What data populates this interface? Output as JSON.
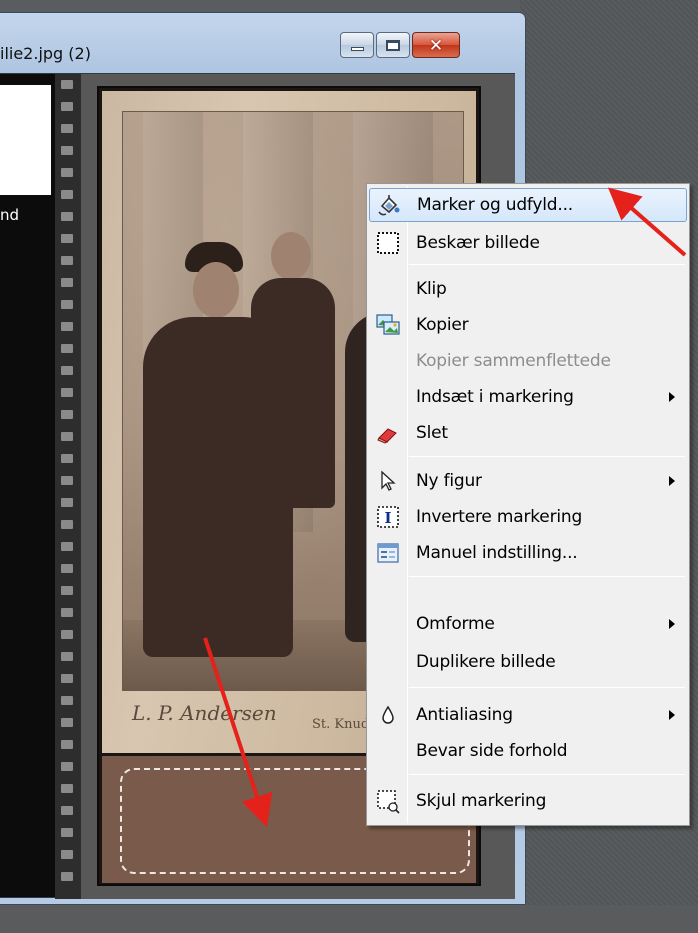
{
  "window": {
    "title": "ilie2.jpg (2)",
    "side_text": "nd"
  },
  "photo": {
    "signature": "L. P. Andersen",
    "address": "St. Knudsgad"
  },
  "context_menu": {
    "items": [
      {
        "label": "Marker og udfyld...",
        "icon": "select-fill-icon",
        "highlighted": true
      },
      {
        "label": "Beskær billede",
        "icon": "crop-icon"
      },
      {
        "label": "Klip",
        "icon": ""
      },
      {
        "label": "Kopier",
        "icon": "copy-image-icon"
      },
      {
        "label": "Kopier sammenflettede",
        "icon": "",
        "disabled": true
      },
      {
        "label": "Indsæt i markering",
        "icon": "",
        "submenu": true
      },
      {
        "label": "Slet",
        "icon": "eraser-icon"
      },
      {
        "label": "Ny figur",
        "icon": "cursor-icon",
        "submenu": true
      },
      {
        "label": "Invertere markering",
        "icon": "invert-selection-icon"
      },
      {
        "label": "Manuel indstilling...",
        "icon": "manual-settings-icon"
      },
      {
        "label": "Omforme",
        "icon": "",
        "submenu": true
      },
      {
        "label": "Duplikere billede",
        "icon": ""
      },
      {
        "label": "Antialiasing",
        "icon": "droplet-icon",
        "submenu": true
      },
      {
        "label": "Bevar side forhold",
        "icon": ""
      },
      {
        "label": "Skjul markering",
        "icon": "hide-selection-icon"
      }
    ]
  },
  "colors": {
    "annotation_arrow": "#e4221b",
    "highlight": "#d5e7fb",
    "selection_fill": "#7a5a4a"
  }
}
